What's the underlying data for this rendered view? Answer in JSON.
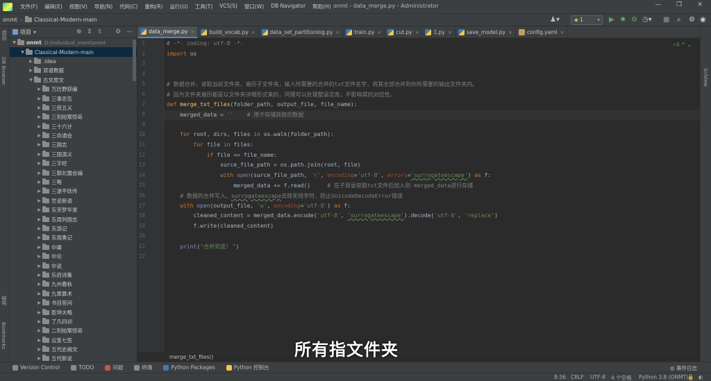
{
  "menubar": {
    "items": [
      "文件(F)",
      "编辑(E)",
      "视图(V)",
      "导航(N)",
      "代码(C)",
      "重构(R)",
      "运行(U)",
      "工具(T)",
      "VCS(S)",
      "窗口(W)",
      "DB Navigator",
      "帮助(H)"
    ],
    "window_title": "onmt - data_merge.py - Administrator"
  },
  "navbar": {
    "project": "onmt",
    "folder": "Classical-Modern-main",
    "run_config": "1"
  },
  "left_strip": {
    "project_label": "项目",
    "db_browser": "DB Browser",
    "structure": "结构",
    "bookmarks": "Bookmarks"
  },
  "right_strip": {
    "sciview": "SciView"
  },
  "project_panel": {
    "title": "项目",
    "root": {
      "name": "onmt",
      "path": "D:\\individual_event\\onmt"
    },
    "main_folder": "Classical-Modern-main",
    "items": [
      {
        "name": ".idea",
        "level": 2
      },
      {
        "name": "双语数据",
        "level": 2
      },
      {
        "name": "古文原文",
        "level": 2,
        "expanded": true
      },
      {
        "name": "万历野获编",
        "level": 3
      },
      {
        "name": "三事忠告",
        "level": 3
      },
      {
        "name": "三侠五义",
        "level": 3
      },
      {
        "name": "三刻拍案惊奇",
        "level": 3
      },
      {
        "name": "三十六计",
        "level": 3
      },
      {
        "name": "三命通会",
        "level": 3
      },
      {
        "name": "三国志",
        "level": 3
      },
      {
        "name": "三国演义",
        "level": 3
      },
      {
        "name": "三字经",
        "level": 3
      },
      {
        "name": "三朝北盟会编",
        "level": 3
      },
      {
        "name": "三略",
        "level": 3
      },
      {
        "name": "三遂平妖传",
        "level": 3
      },
      {
        "name": "世说新语",
        "level": 3
      },
      {
        "name": "东京梦华录",
        "level": 3
      },
      {
        "name": "东周列国志",
        "level": 3
      },
      {
        "name": "东游记",
        "level": 3
      },
      {
        "name": "东观奏记",
        "level": 3
      },
      {
        "name": "中庸",
        "level": 3
      },
      {
        "name": "中论",
        "level": 3
      },
      {
        "name": "中说",
        "level": 3
      },
      {
        "name": "乐府诗集",
        "level": 3
      },
      {
        "name": "九州春秋",
        "level": 3
      },
      {
        "name": "九章算术",
        "level": 3
      },
      {
        "name": "书目答问",
        "level": 3
      },
      {
        "name": "乾坤大略",
        "level": 3
      },
      {
        "name": "了凡四训",
        "level": 3
      },
      {
        "name": "二刻拍案惊奇",
        "level": 3
      },
      {
        "name": "云笈七签",
        "level": 3
      },
      {
        "name": "五代史阙文",
        "level": 3
      },
      {
        "name": "五代新说",
        "level": 3
      }
    ]
  },
  "tabs": [
    {
      "label": "data_merge.py",
      "kind": "py",
      "active": true
    },
    {
      "label": "build_vocab.py",
      "kind": "py"
    },
    {
      "label": "data_set_partitioning.py",
      "kind": "py"
    },
    {
      "label": "train.py",
      "kind": "py"
    },
    {
      "label": "cut.py",
      "kind": "py"
    },
    {
      "label": "1.py",
      "kind": "py"
    },
    {
      "label": "save_model.py",
      "kind": "py"
    },
    {
      "label": "config.yaml",
      "kind": "yaml"
    }
  ],
  "editor": {
    "inspection": "⚡4",
    "current_line": 8,
    "line_numbers": [
      "1",
      "2",
      "3",
      "4",
      "5",
      "6",
      "7",
      "8",
      "9",
      "10",
      "11",
      "12",
      "13",
      "14",
      "15",
      "16",
      "17",
      "18",
      "19",
      "20",
      "21",
      "22"
    ],
    "lines": [
      "# -*- coding: utf-8 -*-",
      "import os",
      "",
      "",
      "# 数据合并，读取当前文件夹，遍历子文件夹，输入所需要的合并的txt文件名字，将其全部合并到你所需要的输出文件夹内。",
      "# 因为文件夹遍历都是以文件夹详细形式来的，同理可以处理整语言库，不影响其的对应性。",
      "def merge_txt_files(folder_path, output_file, file_name):",
      "    merged_data = ''    # 用于存储获取的数据",
      "",
      "    for root, dirs, files in os.walk(folder_path):",
      "        for file in files:",
      "            if file == file_name:",
      "                surce_file_path = os.path.join(root, file)",
      "                with open(surce_file_path, 'r', encoding='utf-8', errors='surrogateescape') as f:",
      "                    merged_data += f.read()     # 在子目录获取txt文件后加入到 merged_data进行存储",
      "    # 数据的合并写入，surrogateescape去除无效字符，防止UnicodeDecodeError错误",
      "    with open(output_file, 'w', encoding='utf-8') as f:",
      "        cleaned_content = merged_data.encode('utf-8', 'surrogateescape').decode('utf-8', 'replace')",
      "        f.write(cleaned_content)",
      "",
      "    print(\"合并完成! \")",
      ""
    ],
    "breadcrumb": "merge_txt_files()"
  },
  "bottom_tools": {
    "items": [
      "Version Control",
      "TODO",
      "问题",
      "终端",
      "Python Packages",
      "Python 控制台"
    ],
    "event_log": "事件日志"
  },
  "statusbar": {
    "time": "8:36",
    "line_sep": "CRLF",
    "encoding": "UTF-8",
    "indent": "4 个空格",
    "interpreter": "Python 3.8 (ONMT)"
  },
  "subtitle": "所有指文件夹",
  "colors": {
    "accent": "#4a88c7",
    "keyword": "#cc7832",
    "string": "#6a8759",
    "comment": "#808080",
    "function": "#ffc66d"
  }
}
